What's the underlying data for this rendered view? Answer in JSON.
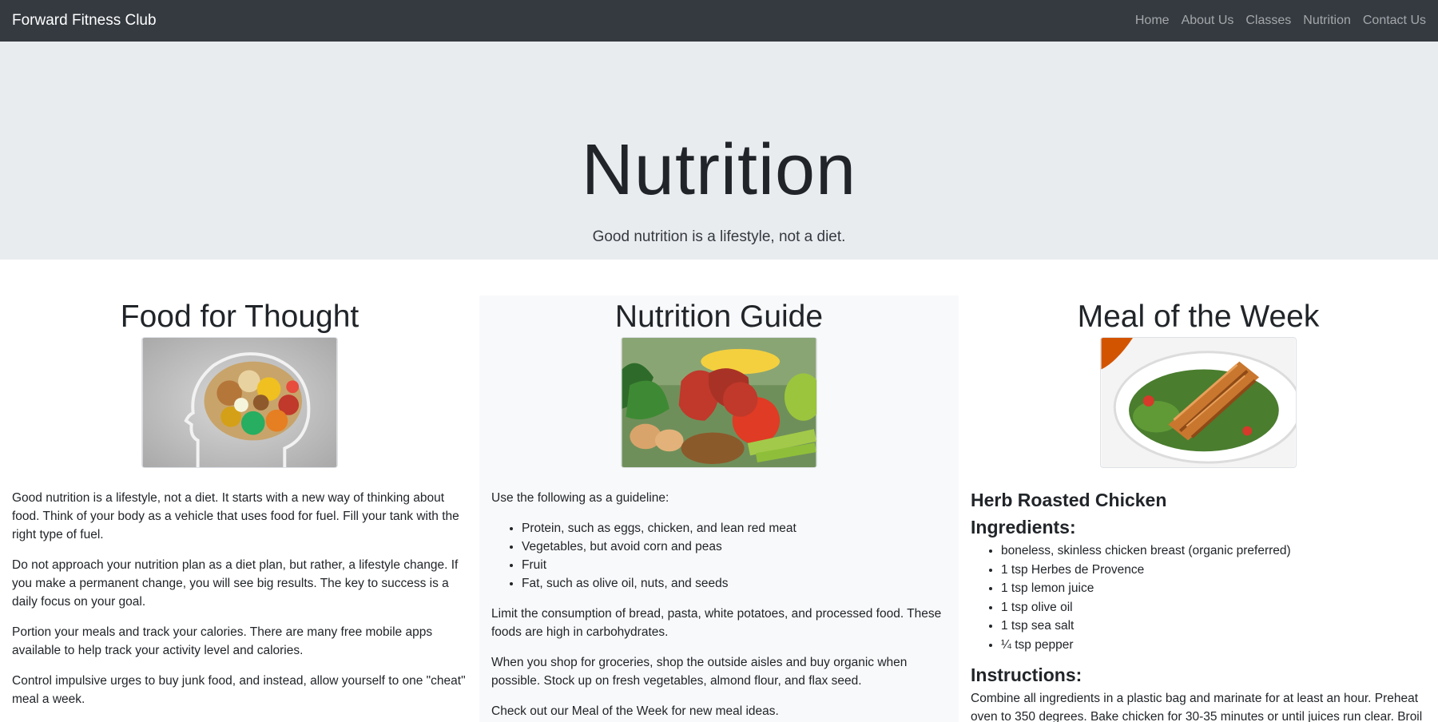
{
  "navbar": {
    "brand": "Forward Fitness Club",
    "links": [
      "Home",
      "About Us",
      "Classes",
      "Nutrition",
      "Contact Us"
    ]
  },
  "hero": {
    "title": "Nutrition",
    "lead": "Good nutrition is a lifestyle, not a diet."
  },
  "food_for_thought": {
    "title": "Food for Thought",
    "paragraphs": [
      "Good nutrition is a lifestyle, not a diet. It starts with a new way of thinking about food. Think of your body as a vehicle that uses food for fuel. Fill your tank with the right type of fuel.",
      "Do not approach your nutrition plan as a diet plan, but rather, a lifestyle change. If you make a permanent change, you will see big results. The key to success is a daily focus on your goal.",
      "Portion your meals and track your calories. There are many free mobile apps available to help track your activity level and calories.",
      "Control impulsive urges to buy junk food, and instead, allow yourself to one \"cheat\" meal a week."
    ]
  },
  "nutrition_guide": {
    "title": "Nutrition Guide",
    "intro": "Use the following as a guideline:",
    "items": [
      "Protein, such as eggs, chicken, and lean red meat",
      "Vegetables, but avoid corn and peas",
      "Fruit",
      "Fat, such as olive oil, nuts, and seeds"
    ],
    "paragraphs": [
      "Limit the consumption of bread, pasta, white potatoes, and processed food. These foods are high in carbohydrates.",
      "When you shop for groceries, shop the outside aisles and buy organic when possible. Stock up on fresh vegetables, almond flour, and flax seed.",
      "Check out our Meal of the Week for new meal ideas."
    ]
  },
  "meal_of_week": {
    "title": "Meal of the Week",
    "recipe_name": "Herb Roasted Chicken",
    "ingredients_heading": "Ingredients:",
    "ingredients": [
      "boneless, skinless chicken breast (organic preferred)",
      "1 tsp Herbes de Provence",
      "1 tsp lemon juice",
      "1 tsp olive oil",
      "1 tsp sea salt",
      "¼ tsp pepper"
    ],
    "instructions_heading": "Instructions:",
    "instructions": "Combine all ingredients in a plastic bag and marinate for at least an hour. Preheat oven to 350 degrees. Bake chicken for 30-35 minutes or until juices run clear. Broil on"
  },
  "colors": {
    "navbar_bg": "#343a40",
    "jumbotron_bg": "#e9ecef",
    "middle_col_bg": "#f8f9fa"
  }
}
